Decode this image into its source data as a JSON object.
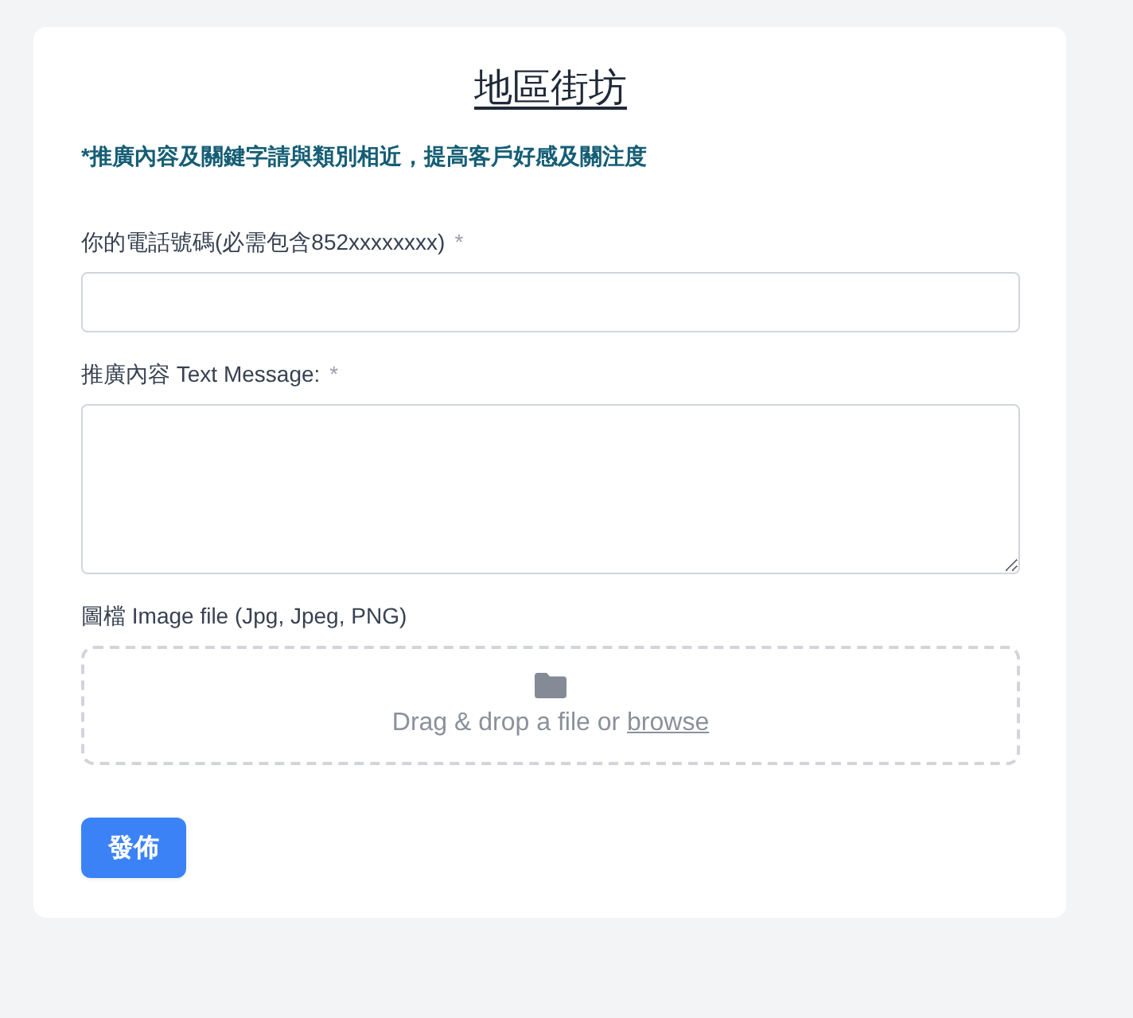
{
  "form": {
    "title": "地區街坊",
    "notice": "*推廣內容及關鍵字請與類別相近，提高客戶好感及關注度",
    "fields": [
      {
        "kind": "text",
        "label": "你的電話號碼(必需包含852xxxxxxxx)",
        "required_mark": "*"
      },
      {
        "kind": "textarea",
        "label": "推廣內容 Text Message:",
        "required_mark": "*"
      },
      {
        "kind": "file",
        "label": "圖檔 Image file (Jpg, Jpeg, PNG)",
        "drop_text": "Drag & drop a file or",
        "browse_link": "browse"
      }
    ],
    "submit_button": "發佈"
  }
}
